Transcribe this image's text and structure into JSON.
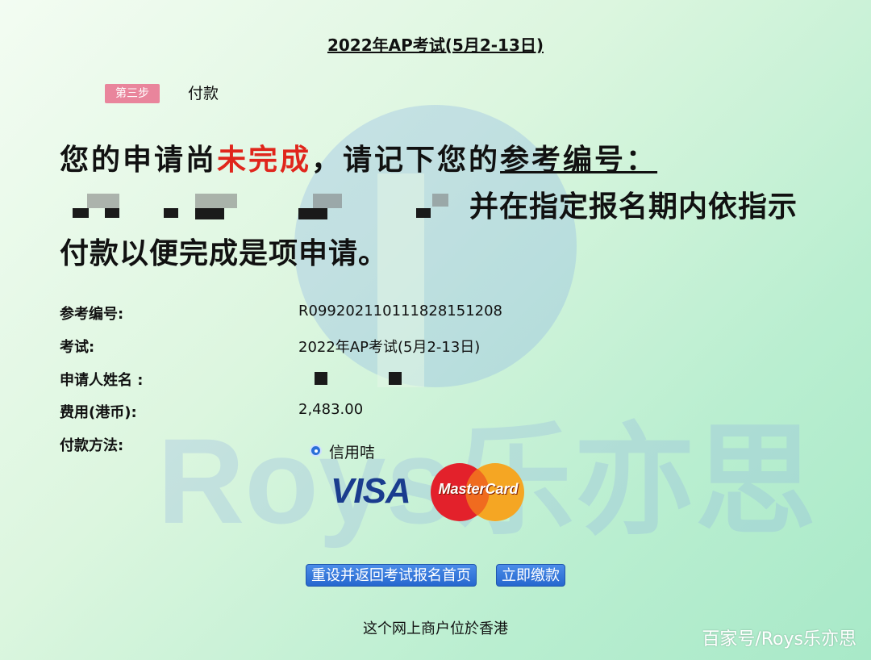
{
  "page": {
    "title": "2022年AP考试(5月2-13日)",
    "step_badge": "第三步",
    "step_label": "付款"
  },
  "headline": {
    "part1": "您的申请尚",
    "part_red": "未完成",
    "part2": "，请记下您的",
    "part_underline": "参考编号：",
    "line2": "并在指定报名期内依指示",
    "line3": "付款以便完成是项申请。"
  },
  "info": {
    "ref_label": "参考编号:",
    "ref_value": "R0992021101118281​51208",
    "exam_label": "考试:",
    "exam_value": "2022年AP考试(5月2-13日)",
    "name_label": "申请人姓名 :",
    "fee_label": "费用(港币):",
    "fee_value": "2,483.00",
    "method_label": "付款方法:",
    "method_option": "信用咭"
  },
  "payment_logos": {
    "visa": "VISA",
    "mastercard": "MasterCard"
  },
  "buttons": {
    "reset": "重设并返回考试报名首页",
    "pay": "立即缴款"
  },
  "footer": {
    "note": "这个网上商户位於香港"
  },
  "watermark": {
    "text": "Roys乐亦思",
    "corner": "百家号/Roys乐亦思"
  },
  "colors": {
    "accent_red": "#e0261c",
    "button_blue": "#2667cf",
    "badge_pink": "#e9859c"
  }
}
